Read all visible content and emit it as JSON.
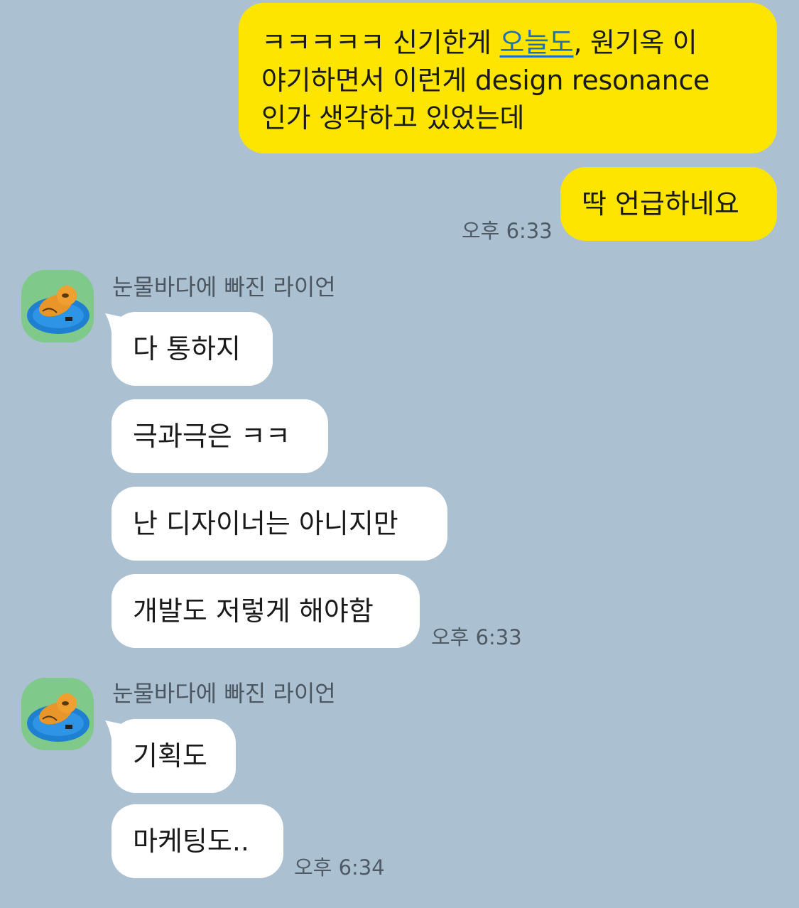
{
  "messages_out": {
    "msg1_line1_pre": "ㅋㅋㅋㅋㅋ 신기한게 ",
    "msg1_link": "오늘도",
    "msg1_line1_post": ", 원기옥 이",
    "msg1_line2": "야기하면서 이런게 design resonance",
    "msg1_line3": "인가 생각하고 있었는데",
    "msg2": "딱 언급하네요",
    "time": "오후 6:33"
  },
  "group1": {
    "sender": "눈물바다에 빠진 라이언",
    "messages": [
      "다 통하지",
      "극과극은 ㅋㅋ",
      "난 디자이너는 아니지만",
      "개발도 저렇게 해야함"
    ],
    "time": "오후 6:33"
  },
  "group2": {
    "sender": "눈물바다에 빠진 라이언",
    "messages": [
      "기획도",
      "마케팅도.."
    ],
    "time": "오후 6:34"
  },
  "colors": {
    "background": "#abc1d1",
    "outgoing_bubble": "#fee500",
    "incoming_bubble": "#ffffff",
    "link": "#1f6fb4"
  },
  "icons": {
    "avatar": "ryan-in-tears-sea-avatar"
  }
}
